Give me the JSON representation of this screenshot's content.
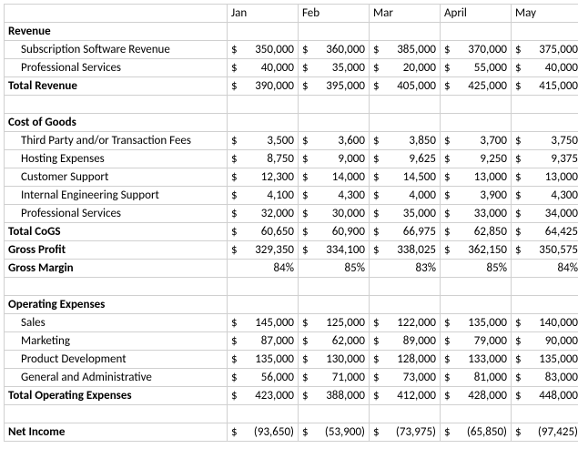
{
  "months": [
    "Jan",
    "Feb",
    "Mar",
    "April",
    "May"
  ],
  "sections": [
    {
      "type": "header",
      "label": "Revenue"
    },
    {
      "type": "line",
      "indent": true,
      "label": "Subscription Software Revenue",
      "values": [
        350000,
        360000,
        385000,
        370000,
        375000
      ]
    },
    {
      "type": "line",
      "indent": true,
      "label": "Professional Services",
      "values": [
        40000,
        35000,
        20000,
        55000,
        40000
      ]
    },
    {
      "type": "total",
      "label": "Total Revenue",
      "values": [
        390000,
        395000,
        405000,
        425000,
        415000
      ]
    },
    {
      "type": "blank"
    },
    {
      "type": "header",
      "label": "Cost of Goods"
    },
    {
      "type": "line",
      "indent": true,
      "label": "Third Party and/or Transaction Fees",
      "values": [
        3500,
        3600,
        3850,
        3700,
        3750
      ]
    },
    {
      "type": "line",
      "indent": true,
      "label": "Hosting Expenses",
      "values": [
        8750,
        9000,
        9625,
        9250,
        9375
      ]
    },
    {
      "type": "line",
      "indent": true,
      "label": "Customer Support",
      "values": [
        12300,
        14000,
        14500,
        13000,
        13000
      ]
    },
    {
      "type": "line",
      "indent": true,
      "label": "Internal Engineering Support",
      "values": [
        4100,
        4300,
        4000,
        3900,
        4300
      ]
    },
    {
      "type": "line",
      "indent": true,
      "label": "Professional Services",
      "values": [
        32000,
        30000,
        35000,
        33000,
        34000
      ]
    },
    {
      "type": "total",
      "label": "Total CoGS",
      "values": [
        60650,
        60900,
        66975,
        62850,
        64425
      ]
    },
    {
      "type": "total",
      "label": "Gross Profit",
      "values": [
        329350,
        334100,
        338025,
        362150,
        350575
      ]
    },
    {
      "type": "percent",
      "label": "Gross Margin",
      "values": [
        84,
        85,
        83,
        85,
        84
      ]
    },
    {
      "type": "blank"
    },
    {
      "type": "header",
      "label": "Operating Expenses"
    },
    {
      "type": "line",
      "indent": true,
      "label": "Sales",
      "values": [
        145000,
        125000,
        122000,
        135000,
        140000
      ]
    },
    {
      "type": "line",
      "indent": true,
      "label": "Marketing",
      "values": [
        87000,
        62000,
        89000,
        79000,
        90000
      ]
    },
    {
      "type": "line",
      "indent": true,
      "label": "Product Development",
      "values": [
        135000,
        130000,
        128000,
        133000,
        135000
      ]
    },
    {
      "type": "line",
      "indent": true,
      "label": "General and Administrative",
      "values": [
        56000,
        71000,
        73000,
        81000,
        83000
      ]
    },
    {
      "type": "total",
      "label": "Total Operating Expenses",
      "values": [
        423000,
        388000,
        412000,
        428000,
        448000
      ]
    },
    {
      "type": "blank"
    },
    {
      "type": "total",
      "label": "Net Income",
      "values": [
        -93650,
        -53900,
        -73975,
        -65850,
        -97425
      ]
    }
  ]
}
